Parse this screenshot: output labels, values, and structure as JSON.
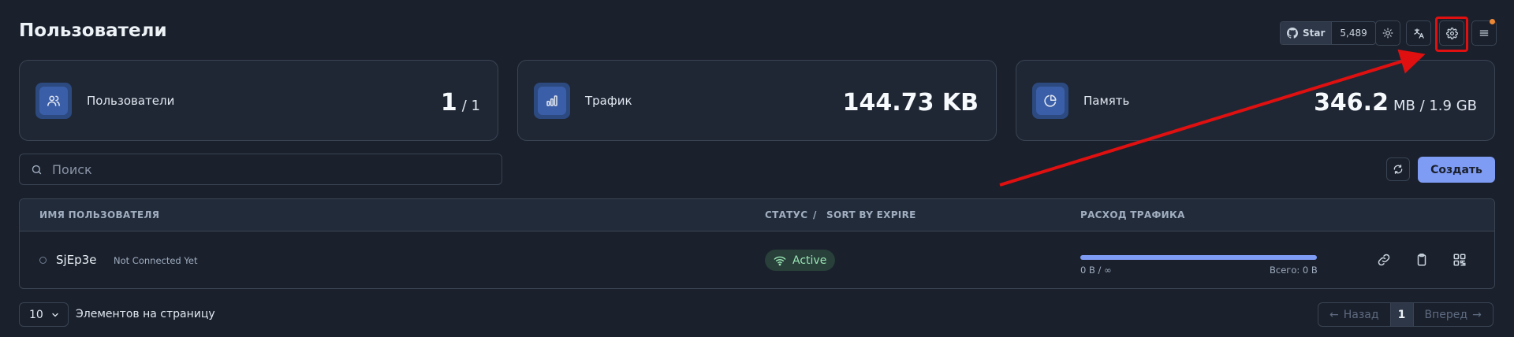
{
  "header": {
    "title": "Пользователи",
    "github": {
      "star_label": "Star",
      "star_count": "5,489"
    },
    "icons": [
      "sun-icon",
      "translate-icon",
      "gear-icon",
      "menu-icon"
    ]
  },
  "cards": [
    {
      "icon": "users-icon",
      "label": "Пользователи",
      "value": "1",
      "suffix": "/ 1"
    },
    {
      "icon": "chart-bars-icon",
      "label": "Трафик",
      "value": "144.73 KB",
      "suffix": ""
    },
    {
      "icon": "pie-chart-icon",
      "label": "Память",
      "value": "346.2",
      "suffix": "MB / 1.9 GB"
    }
  ],
  "search": {
    "placeholder": "Поиск",
    "value": ""
  },
  "actions": {
    "create_label": "Создать"
  },
  "table": {
    "headers": {
      "username": "ИМЯ ПОЛЬЗОВАТЕЛЯ",
      "status": "СТАТУС",
      "separator": "/",
      "sort": "SORT BY EXPIRE",
      "usage": "РАСХОД ТРАФИКА"
    },
    "rows": [
      {
        "username": "SjEp3e",
        "connection": "Not Connected Yet",
        "status": "Active",
        "usage_used": "0 B / ∞",
        "usage_total": "Всего: 0 B",
        "usage_fraction": 1.0
      }
    ]
  },
  "pagination": {
    "per_page": "10",
    "per_page_label": "Элементов на страницу",
    "prev_label": "Назад",
    "current_page": "1",
    "next_label": "Вперед"
  },
  "colors": {
    "background": "#1a202c",
    "accent": "#7f9cf5",
    "active": "#9ae6b4",
    "annotation": "#e01010",
    "notification": "#ed8936"
  }
}
